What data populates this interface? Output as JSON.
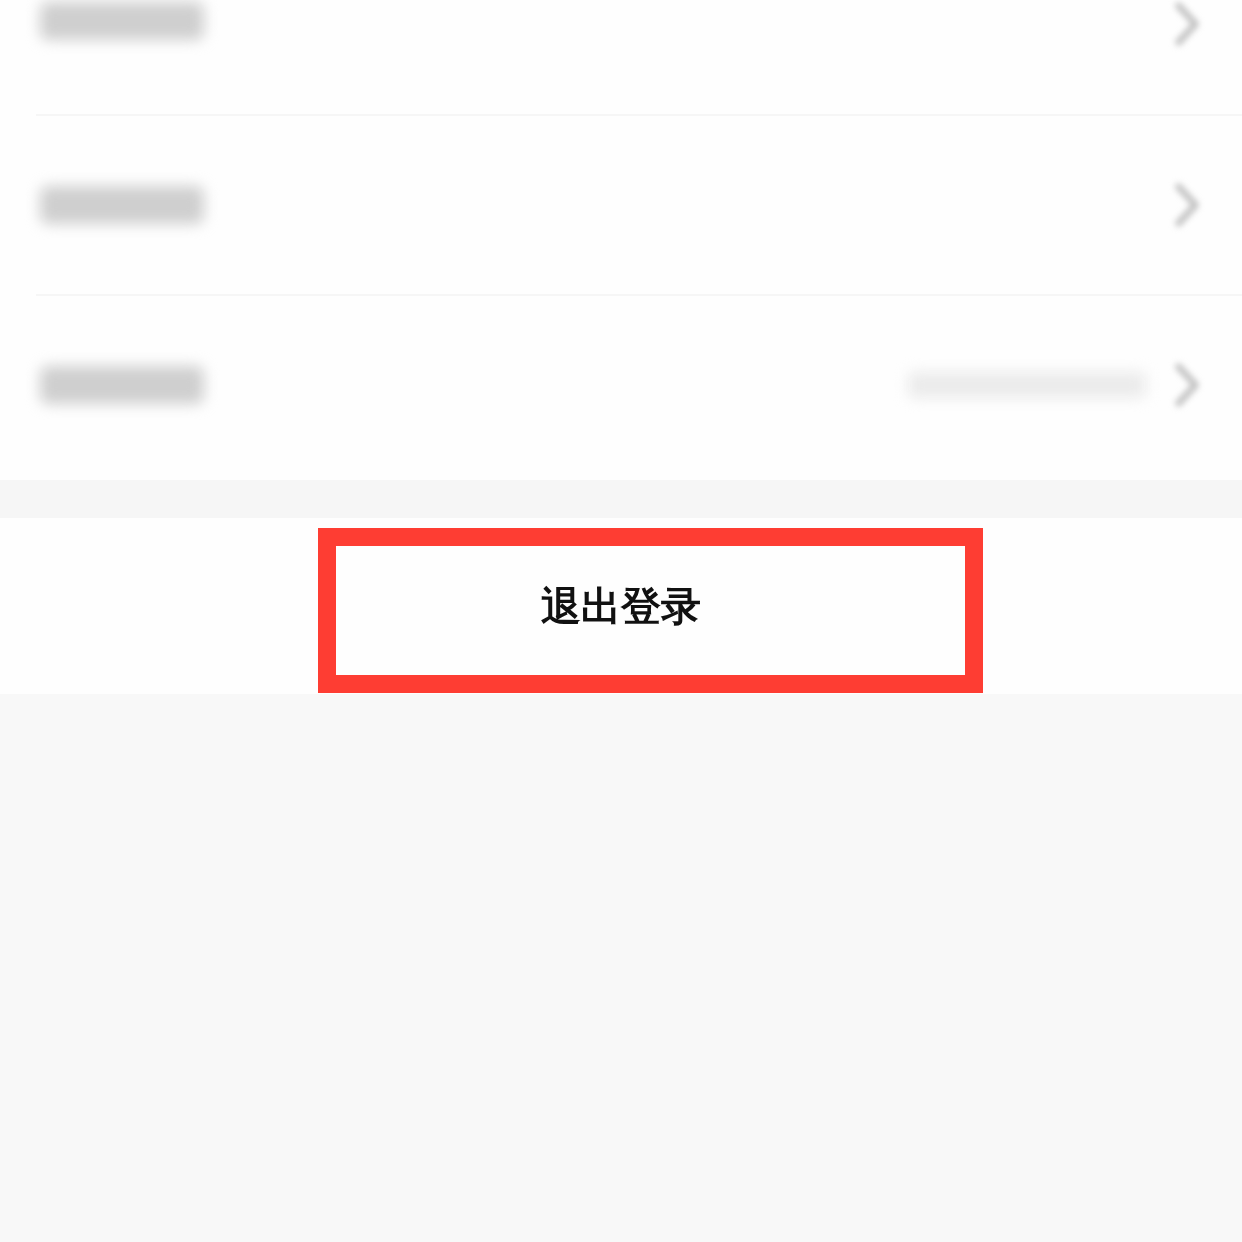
{
  "settings_rows": [
    {
      "detail": false
    },
    {
      "detail": false
    },
    {
      "detail": true
    }
  ],
  "logout_button": {
    "label": "退出登录",
    "highlighted": true
  }
}
